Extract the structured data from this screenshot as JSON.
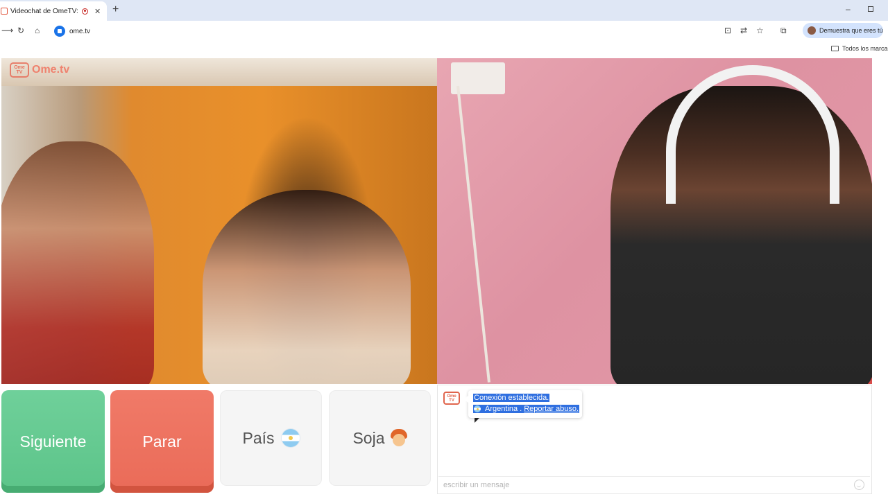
{
  "browser": {
    "tab_title": "Videochat de OmeTV: una",
    "tab_close": "✕",
    "new_tab": "+",
    "minimize": "–",
    "back": "⟶",
    "reload": "↻",
    "home": "⌂",
    "url": "ome.tv",
    "profile_label": "Demuestra que eres tú",
    "bookmarks_label": "Todos los marcad"
  },
  "video": {
    "logo_icon_text": "Ome TV",
    "logo_text": "Ome.tv"
  },
  "controls": {
    "next_label": "Siguiente",
    "stop_label": "Parar",
    "country_label": "País",
    "gender_label": "Soja"
  },
  "chat": {
    "logo_text": "Ome TV",
    "message_line1": "Conexión establecida.",
    "country_name": "Argentina .",
    "report_link": "Reportar abuso.",
    "input_placeholder": "escribir un mensaje"
  },
  "colors": {
    "next_button": "#5cc489",
    "stop_button": "#ea6b58",
    "selection": "#2f6fe0",
    "brand": "#e0654d"
  },
  "icons": {
    "country_flag": "argentina-flag-icon",
    "gender_avatar": "boy-emoji-icon",
    "emoji_picker": "smiley-icon"
  }
}
